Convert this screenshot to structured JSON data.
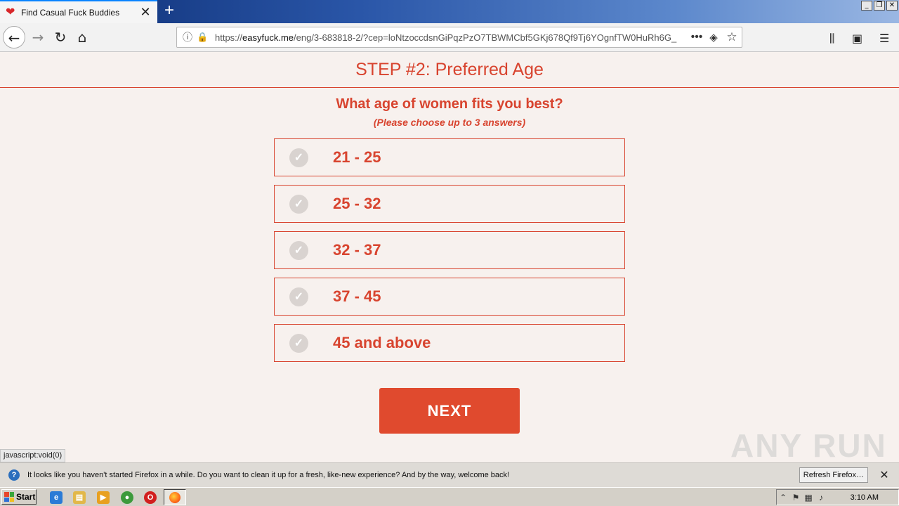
{
  "browser": {
    "tab_title": "Find Casual Fuck Buddies",
    "url_prefix": "https://",
    "url_domain": "easyfuck.me",
    "url_rest": "/eng/3-683818-2/?cep=loNtzoccdsnGiPqzPzO7TBWMCbf5GKj678Qf9Tj6YOgnfTW0HuRh6G_"
  },
  "page": {
    "step_title": "STEP #2: Preferred Age",
    "question": "What age of women fits you best?",
    "hint": "(Please choose up to 3 answers)",
    "options": [
      {
        "label": "21 - 25"
      },
      {
        "label": "25 - 32"
      },
      {
        "label": "32 - 37"
      },
      {
        "label": "37 - 45"
      },
      {
        "label": "45 and above"
      }
    ],
    "next_label": "NEXT",
    "status_link": "javascript:void(0)",
    "watermark": "ANY RUN"
  },
  "notification": {
    "message": "It looks like you haven't started Firefox in a while. Do you want to clean it up for a fresh, like-new experience? And by the way, welcome back!",
    "button": "Refresh Firefox…"
  },
  "taskbar": {
    "start_label": "Start",
    "clock": "3:10 AM"
  },
  "icons": {
    "tab_favicon": "heart-icon",
    "check": "checkmark-icon"
  },
  "colors": {
    "accent": "#d8442f",
    "button": "#e04a2e",
    "page_bg": "#f7f1ee"
  }
}
